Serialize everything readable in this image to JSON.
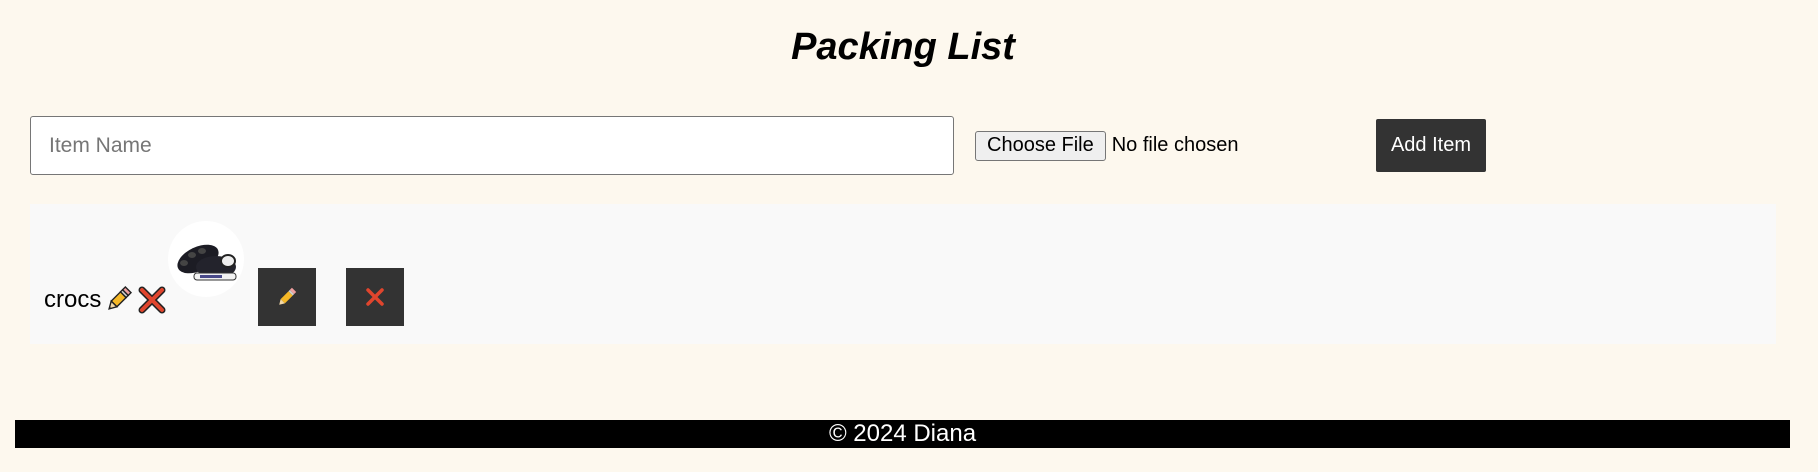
{
  "header": {
    "title": "Packing List"
  },
  "form": {
    "item_placeholder": "Item Name",
    "item_value": "",
    "file_button_label": "Choose File",
    "file_status": "No file chosen",
    "add_button_label": "Add Item"
  },
  "items": [
    {
      "name": "crocs",
      "inline_icons": [
        "pencil-icon",
        "cross-mark-icon"
      ],
      "image": "black-crocs-clogs",
      "image_brand_text": "crocs",
      "edit_icon": "pencil-icon",
      "delete_icon": "cross-mark-icon"
    }
  ],
  "footer": {
    "text": "© 2024 Diana"
  },
  "colors": {
    "page_background": "#fdf8ee",
    "panel_background": "#f9f9f9",
    "button_background": "#333333",
    "footer_background": "#000000",
    "pencil_yellow": "#f5b827",
    "cross_red": "#e0452d"
  }
}
